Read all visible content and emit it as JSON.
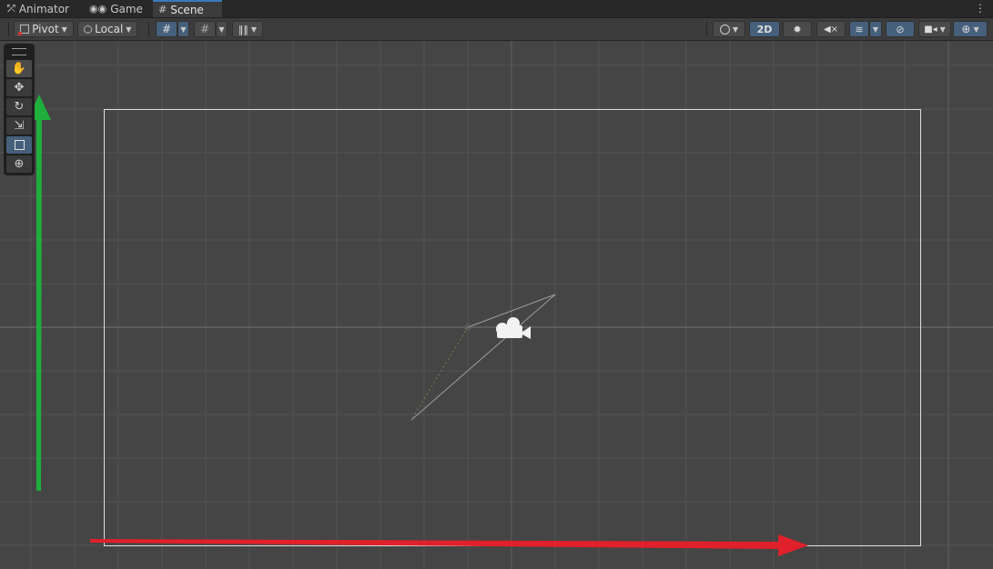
{
  "tabs": [
    {
      "label": "Animator",
      "icon": "animator-icon"
    },
    {
      "label": "Game",
      "icon": "gamepad-icon"
    },
    {
      "label": "Scene",
      "icon": "grid-hash-icon",
      "active": true
    }
  ],
  "toolbar": {
    "pivot_label": "Pivot",
    "local_label": "Local",
    "mode_2d_label": "2D",
    "accent_color": "#46607c"
  },
  "tools": [
    {
      "name": "hand-tool",
      "icon": "hand-icon"
    },
    {
      "name": "move-tool",
      "icon": "move-arrows-icon"
    },
    {
      "name": "rotate-tool",
      "icon": "rotate-icon"
    },
    {
      "name": "scale-tool",
      "icon": "scale-icon"
    },
    {
      "name": "rect-tool",
      "icon": "rect-transform-icon",
      "selected": true
    },
    {
      "name": "transform-tool",
      "icon": "transform-icon"
    }
  ],
  "annotations": {
    "x_arrow_color": "#e0202a",
    "y_arrow_color": "#1fae3c"
  }
}
